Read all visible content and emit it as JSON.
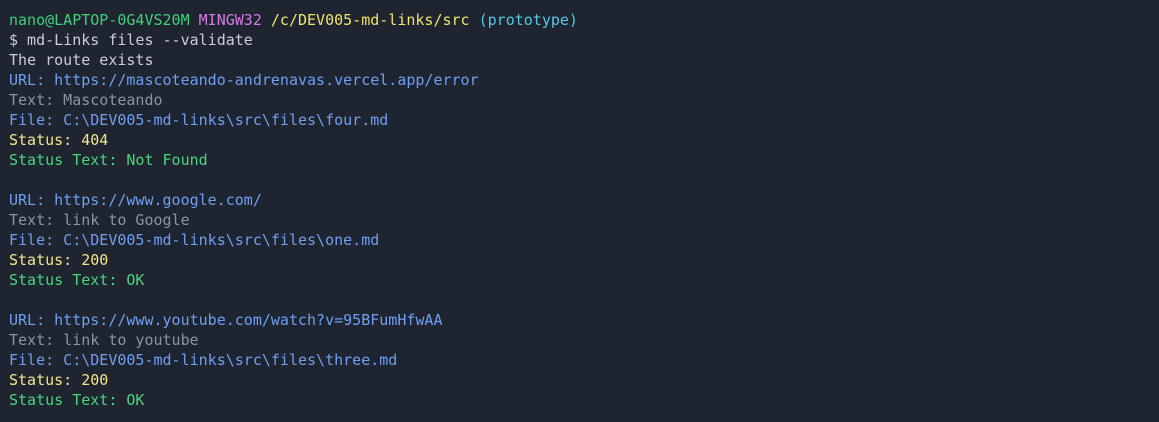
{
  "prompt": {
    "user_host": "nano@LAPTOP-0G4VS20M",
    "system": "MINGW32",
    "path": "/c/DEV005-md-links/src",
    "branch": "(prototype)"
  },
  "command": "$ md-Links files --validate",
  "message": "The route exists",
  "links": [
    {
      "url": "URL: https://mascoteando-andrenavas.vercel.app/error",
      "text": "Text: Mascoteando",
      "file": "File: C:\\DEV005-md-links\\src\\files\\four.md",
      "status": "Status: 404",
      "status_text": "Status Text: Not Found"
    },
    {
      "url": "URL: https://www.google.com/",
      "text": "Text: link to Google",
      "file": "File: C:\\DEV005-md-links\\src\\files\\one.md",
      "status": "Status: 200",
      "status_text": "Status Text: OK"
    },
    {
      "url": "URL: https://www.youtube.com/watch?v=95BFumHfwAA",
      "text": "Text: link to youtube",
      "file": "File: C:\\DEV005-md-links\\src\\files\\three.md",
      "status": "Status: 200",
      "status_text": "Status Text: OK"
    }
  ],
  "colors": {
    "background": "#1e2430",
    "user_host": "#3fd17a",
    "system": "#d67be6",
    "path": "#f0e36a",
    "branch": "#56c7e3",
    "url": "#6f9ff2",
    "text": "#8e949e",
    "status": "#f3e68a",
    "status_text": "#48d67f"
  }
}
